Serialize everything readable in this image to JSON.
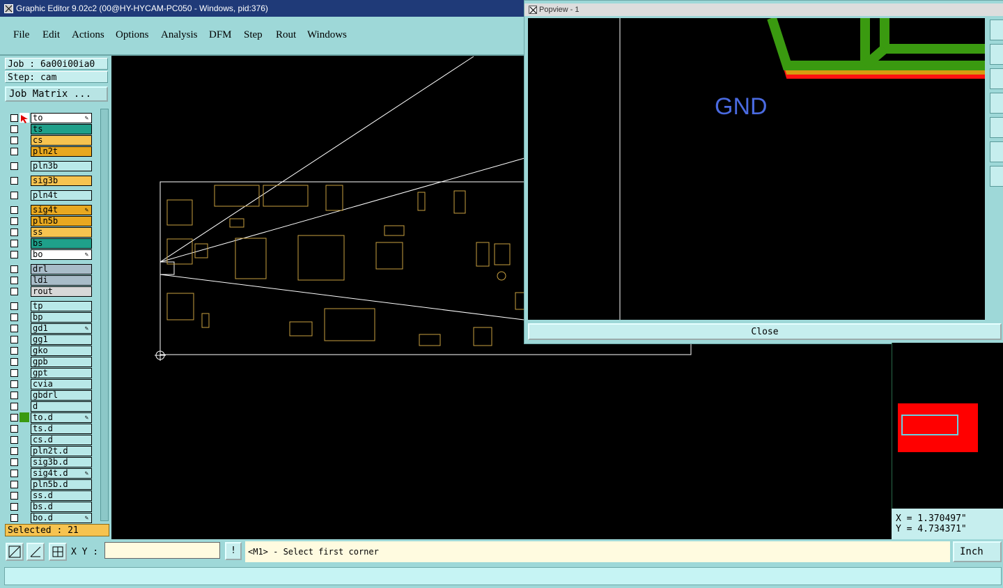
{
  "app": {
    "title": "Graphic Editor 9.02c2 (00@HY-HYCAM-PC050 - Windows, pid:376)"
  },
  "menu": [
    "File",
    "Edit",
    "Actions",
    "Options",
    "Analysis",
    "DFM",
    "Step",
    "Rout",
    "Windows"
  ],
  "job": {
    "job_label": "Job : 6a00i00ia0",
    "step_label": "Step: cam",
    "matrix_button": "Job Matrix ..."
  },
  "layers": [
    {
      "name": "to",
      "color": "#ffffff",
      "marker": "red-arrow",
      "lock": true
    },
    {
      "name": "ts",
      "color": "#1fa08a"
    },
    {
      "name": "cs",
      "color": "#f6c350"
    },
    {
      "name": "pln2t",
      "color": "#e8a820"
    },
    {
      "name": "pln3b",
      "color": "#b8e8e8"
    },
    {
      "name": "sig3b",
      "color": "#f6c350"
    },
    {
      "name": "pln4t",
      "color": "#b8e8e8"
    },
    {
      "name": "sig4t",
      "color": "#e8a820",
      "lock": true
    },
    {
      "name": "pln5b",
      "color": "#e8a820"
    },
    {
      "name": "ss",
      "color": "#f6c350"
    },
    {
      "name": "bs",
      "color": "#1fa08a"
    },
    {
      "name": "bo",
      "color": "#ffffff",
      "lock": true
    },
    {
      "name": "drl",
      "color": "#a8bcc8"
    },
    {
      "name": "ldi",
      "color": "#a8bcc8"
    },
    {
      "name": "rout",
      "color": "#d8d8d8"
    },
    {
      "name": "tp",
      "color": "#b8e8e8"
    },
    {
      "name": "bp",
      "color": "#b8e8e8"
    },
    {
      "name": "gd1",
      "color": "#b8e8e8",
      "lock": true
    },
    {
      "name": "gg1",
      "color": "#b8e8e8"
    },
    {
      "name": "gko",
      "color": "#b8e8e8"
    },
    {
      "name": "gpb",
      "color": "#b8e8e8"
    },
    {
      "name": "gpt",
      "color": "#b8e8e8"
    },
    {
      "name": "cvia",
      "color": "#b8e8e8"
    },
    {
      "name": "gbdrl",
      "color": "#b8e8e8"
    },
    {
      "name": "d",
      "color": "#b8e8e8"
    },
    {
      "name": "to.d",
      "color": "#b8e8e8",
      "marker": "green",
      "lock": true
    },
    {
      "name": "ts.d",
      "color": "#b8e8e8"
    },
    {
      "name": "cs.d",
      "color": "#b8e8e8"
    },
    {
      "name": "pln2t.d",
      "color": "#b8e8e8"
    },
    {
      "name": "sig3b.d",
      "color": "#b8e8e8"
    },
    {
      "name": "sig4t.d",
      "color": "#b8e8e8",
      "lock": true
    },
    {
      "name": "pln5b.d",
      "color": "#b8e8e8"
    },
    {
      "name": "ss.d",
      "color": "#b8e8e8"
    },
    {
      "name": "bs.d",
      "color": "#b8e8e8"
    },
    {
      "name": "bo.d",
      "color": "#b8e8e8",
      "lock": true
    }
  ],
  "selected": "Selected : 21",
  "popview": {
    "title": "Popview - 1",
    "net_label": "GND",
    "close_label": "Close"
  },
  "coords": {
    "x": "X = 1.370497\"",
    "y": "Y = 4.734371\""
  },
  "bottom": {
    "xy_label": "X Y :",
    "xy_value": "",
    "bang": "!",
    "message": "<M1> - Select first corner",
    "unit": "Inch"
  },
  "colors": {
    "panel": "#9ed8d8",
    "board_outline": "#ffffff",
    "components": "#c8a040",
    "trace_green": "#3a9a10",
    "trace_red": "#ff1010",
    "overview_red": "#ff0000"
  }
}
